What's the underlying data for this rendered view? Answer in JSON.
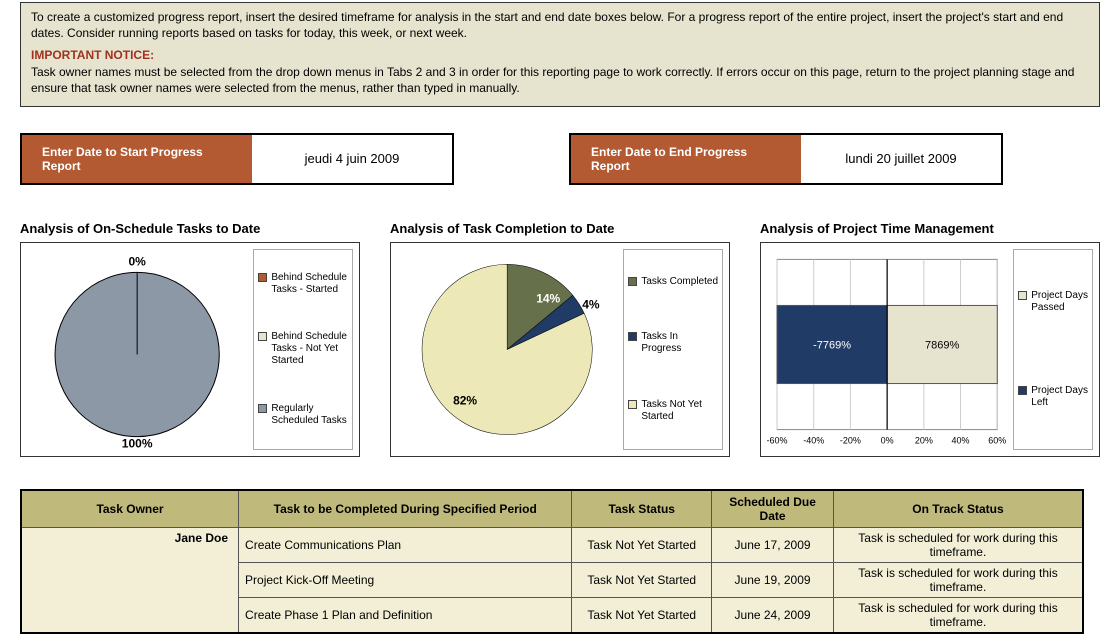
{
  "notice": {
    "p1": "To create a customized progress report, insert the desired timeframe for analysis in the start and end date boxes below. For a progress report of the entire project, insert the project's start and end dates. Consider running reports based on tasks for today, this week, or next week.",
    "warn_title": "IMPORTANT NOTICE:",
    "p2": "Task owner names must be selected from the drop down menus in Tabs 2 and 3 in order for this reporting page to work correctly. If errors occur on this page, return to the project planning stage and ensure that task owner names were selected from the menus, rather than typed in manually."
  },
  "dates": {
    "start_label": "Enter Date to Start Progress Report",
    "start_value": "jeudi 4 juin 2009",
    "end_label": "Enter Date to End Progress Report",
    "end_value": "lundi 20 juillet 2009"
  },
  "chart1": {
    "title": "Analysis of On-Schedule Tasks to Date",
    "labels": {
      "top": "0%",
      "bottom": "100%"
    },
    "legend": [
      "Behind Schedule Tasks - Started",
      "Behind Schedule Tasks - Not Yet Started",
      "Regularly Scheduled Tasks"
    ]
  },
  "chart2": {
    "title": "Analysis of Task Completion to Date",
    "labels": {
      "a": "14%",
      "b": "4%",
      "c": "82%"
    },
    "legend": [
      "Tasks Completed",
      "Tasks In Progress",
      "Tasks Not Yet Started"
    ]
  },
  "chart3": {
    "title": "Analysis of Project Time Management",
    "labels": {
      "left": "-7769%",
      "right": "7869%"
    },
    "ticks": [
      "-60%",
      "-40%",
      "-20%",
      "0%",
      "20%",
      "40%",
      "60%"
    ],
    "legend": [
      "Project Days Passed",
      "Project Days Left"
    ]
  },
  "table": {
    "headers": [
      "Task Owner",
      "Task to be Completed During Specified Period",
      "Task Status",
      "Scheduled Due Date",
      "On Track Status"
    ],
    "owner": "Jane Doe",
    "rows": [
      {
        "task": "Create Communications Plan",
        "status": "Task Not Yet Started",
        "due": "June 17, 2009",
        "track": "Task is scheduled for work during this timeframe."
      },
      {
        "task": "Project Kick-Off Meeting",
        "status": "Task Not Yet Started",
        "due": "June 19, 2009",
        "track": "Task is scheduled for work during this timeframe."
      },
      {
        "task": "Create Phase 1 Plan and Definition",
        "status": "Task Not Yet Started",
        "due": "June 24, 2009",
        "track": "Task is scheduled for work during this timeframe."
      }
    ]
  },
  "chart_data": [
    {
      "type": "pie",
      "title": "Analysis of On-Schedule Tasks to Date",
      "categories": [
        "Behind Schedule Tasks - Started",
        "Behind Schedule Tasks - Not Yet Started",
        "Regularly Scheduled Tasks"
      ],
      "values": [
        0,
        0,
        100
      ]
    },
    {
      "type": "pie",
      "title": "Analysis of Task Completion to Date",
      "categories": [
        "Tasks Completed",
        "Tasks In Progress",
        "Tasks Not Yet Started"
      ],
      "values": [
        14,
        4,
        82
      ]
    },
    {
      "type": "bar",
      "title": "Analysis of Project Time Management",
      "categories": [
        "Project Days Passed",
        "Project Days Left"
      ],
      "values": [
        7869,
        -7769
      ],
      "xlabel": "",
      "ylabel": "",
      "ylim": [
        -60,
        60
      ]
    }
  ]
}
